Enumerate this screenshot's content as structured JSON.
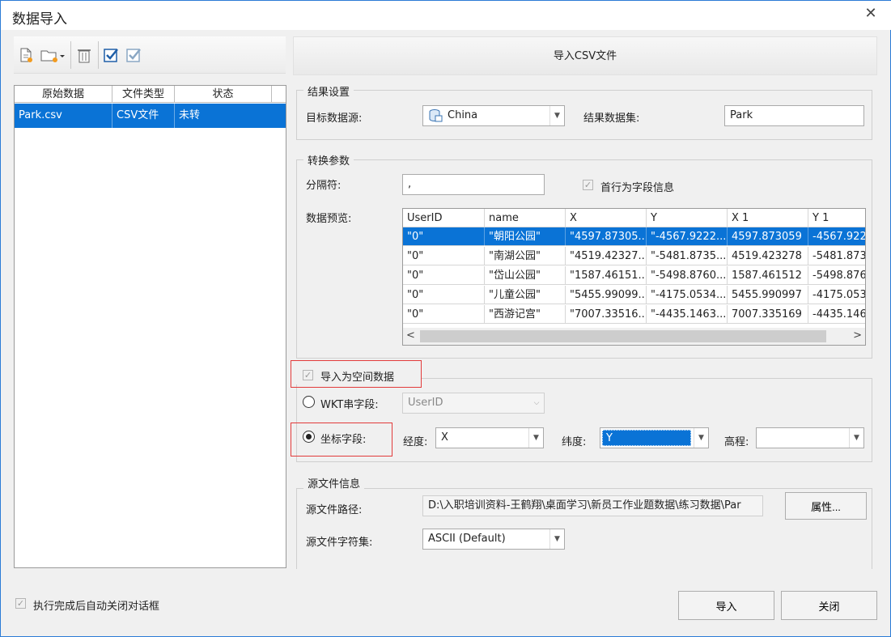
{
  "window": {
    "title": "数据导入",
    "close_glyph": "✕"
  },
  "toolbar": {
    "icons": [
      "new-file-icon",
      "add-folder-icon",
      "delete-icon",
      "select-all-icon",
      "select-invert-icon"
    ]
  },
  "file_list": {
    "columns": [
      "原始数据",
      "文件类型",
      "状态"
    ],
    "rows": [
      {
        "name": "Park.csv",
        "type": "CSV文件",
        "status": "未转"
      }
    ]
  },
  "banner": {
    "label": "导入CSV文件"
  },
  "result_settings": {
    "legend": "结果设置",
    "target_label": "目标数据源:",
    "target_value": "China",
    "dataset_label": "结果数据集:",
    "dataset_value": "Park"
  },
  "convert_params": {
    "legend": "转换参数",
    "separator_label": "分隔符:",
    "separator_value": ",",
    "first_row_label": "首行为字段信息",
    "preview_label": "数据预览:",
    "columns": [
      "UserID",
      "name",
      "X",
      "Y",
      "X 1",
      "Y 1"
    ],
    "rows": [
      [
        "\"0\"",
        "\"朝阳公园\"",
        "\"4597.87305...",
        "\"-4567.9222...",
        "4597.873059",
        "-4567.922"
      ],
      [
        "\"0\"",
        "\"南湖公园\"",
        "\"4519.42327...",
        "\"-5481.8735...",
        "4519.423278",
        "-5481.873"
      ],
      [
        "\"0\"",
        "\"岱山公园\"",
        "\"1587.46151...",
        "\"-5498.8760...",
        "1587.461512",
        "-5498.876"
      ],
      [
        "\"0\"",
        "\"儿童公园\"",
        "\"5455.99099...",
        "\"-4175.0534...",
        "5455.990997",
        "-4175.053"
      ],
      [
        "\"0\"",
        "\"西游记宫\"",
        "\"7007.33516...",
        "\"-4435.1463...",
        "7007.335169",
        "-4435.146"
      ]
    ],
    "scroll_left": "<",
    "scroll_right": ">"
  },
  "spatial": {
    "checkbox_label": "导入为空间数据",
    "wkt_label": "WKT串字段:",
    "wkt_value": "UserID",
    "coord_label": "坐标字段:",
    "lon_label": "经度:",
    "lon_value": "X",
    "lat_label": "纬度:",
    "lat_value": "Y",
    "elev_label": "高程:",
    "elev_value": ""
  },
  "source_info": {
    "legend": "源文件信息",
    "path_label": "源文件路径:",
    "path_value": "D:\\入职培训资料-王鹤翔\\桌面学习\\新员工作业题数据\\练习数据\\Par",
    "props_button": "属性...",
    "charset_label": "源文件字符集:",
    "charset_value": "ASCII (Default)"
  },
  "footer": {
    "auto_close_label": "执行完成后自动关闭对话框",
    "import_button": "导入",
    "close_button": "关闭"
  },
  "colors": {
    "selection": "#0a73d6",
    "highlight_box": "#e23b3b"
  }
}
